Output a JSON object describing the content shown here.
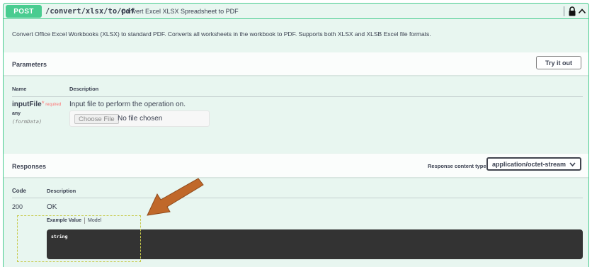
{
  "operation": {
    "method": "POST",
    "path": "/convert/xlsx/to/pdf",
    "summary": "Convert Excel XLSX Spreadsheet to PDF",
    "description": "Convert Office Excel Workbooks (XLSX) to standard PDF. Converts all worksheets in the workbook to PDF. Supports both XLSX and XLSB Excel file formats.",
    "icons": [
      "lock-icon",
      "chevron-up-icon"
    ]
  },
  "parameters": {
    "title": "Parameters",
    "try_label": "Try it out",
    "col_name": "Name",
    "col_description": "Description",
    "items": [
      {
        "name": "inputFile",
        "required_marker": "*",
        "required_label": "required",
        "type": "any",
        "in": "(formData)",
        "description": "Input file to perform the operation on.",
        "choose_file_label": "Choose File",
        "no_file_text": "No file chosen"
      }
    ]
  },
  "responses": {
    "title": "Responses",
    "content_type_label": "Response content type",
    "content_type_value": "application/octet-stream",
    "col_code": "Code",
    "col_description": "Description",
    "items": [
      {
        "code": "200",
        "description": "OK",
        "tab_example": "Example Value",
        "tab_model": "Model",
        "example": "string"
      }
    ]
  },
  "colors": {
    "post": "#49cc90",
    "block_bg": "#e8f6f0",
    "arrow": "#c0682a",
    "highlight_dash": "#c7c94b"
  }
}
